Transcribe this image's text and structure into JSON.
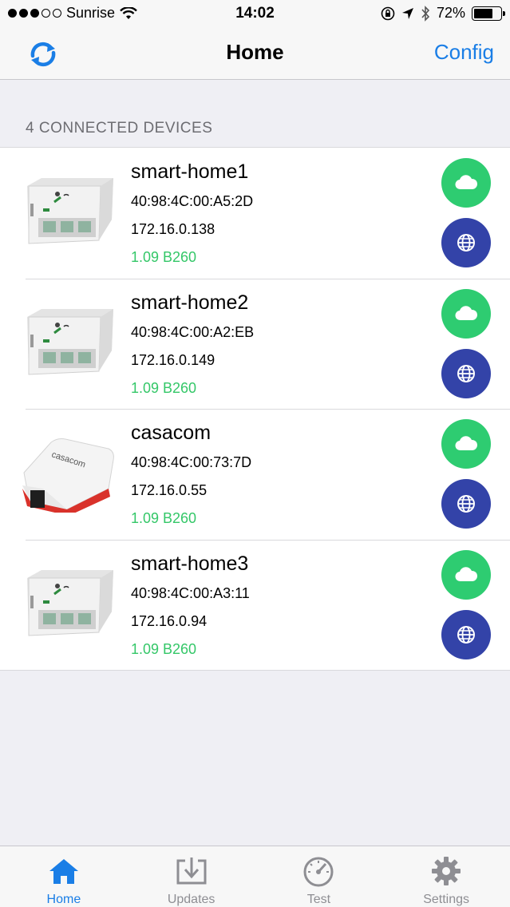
{
  "status_bar": {
    "carrier": "Sunrise",
    "time": "14:02",
    "battery": "72%",
    "battery_level": 0.72
  },
  "nav": {
    "title": "Home",
    "config_label": "Config"
  },
  "section_header": "4 CONNECTED DEVICES",
  "devices": [
    {
      "name": "smart-home1",
      "mac": "40:98:4C:00:A5:2D",
      "ip": "172.16.0.138",
      "firmware": "1.09 B260",
      "image": "smart-home-module"
    },
    {
      "name": "smart-home2",
      "mac": "40:98:4C:00:A2:EB",
      "ip": "172.16.0.149",
      "firmware": "1.09 B260",
      "image": "smart-home-module"
    },
    {
      "name": "casacom",
      "mac": "40:98:4C:00:73:7D",
      "ip": "172.16.0.55",
      "firmware": "1.09 B260",
      "image": "casacom-plug",
      "image_label": "casacom"
    },
    {
      "name": "smart-home3",
      "mac": "40:98:4C:00:A3:11",
      "ip": "172.16.0.94",
      "firmware": "1.09 B260",
      "image": "smart-home-module"
    }
  ],
  "tabs": [
    {
      "label": "Home",
      "icon": "home-icon",
      "active": true
    },
    {
      "label": "Updates",
      "icon": "download-icon",
      "active": false
    },
    {
      "label": "Test",
      "icon": "speedometer-icon",
      "active": false
    },
    {
      "label": "Settings",
      "icon": "gear-icon",
      "active": false
    }
  ],
  "colors": {
    "accent": "#1a7ee6",
    "cloud_button": "#2ecc71",
    "web_button": "#3343a8",
    "firmware_text": "#34c768"
  }
}
